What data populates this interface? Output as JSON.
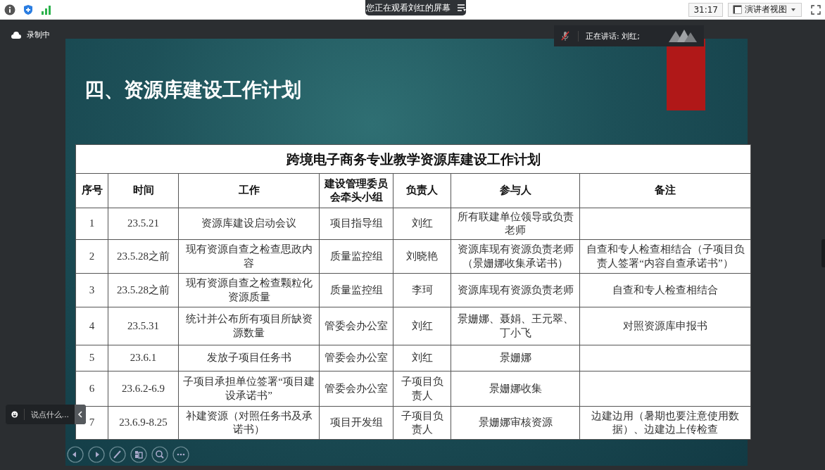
{
  "top_bar": {
    "viewing_banner": "您正在观看刘红的屏幕",
    "timer": "31:17",
    "view_button": "演讲者视图"
  },
  "recording": "录制中",
  "speaking": "正在讲话: 刘红;",
  "slide": {
    "title": "四、资源库建设工作计划",
    "table": {
      "caption": "跨境电子商务专业教学资源库建设工作计划",
      "columns": [
        "序号",
        "时间",
        "工作",
        "建设管理委员会牵头小组",
        "负责人",
        "参与人",
        "备注"
      ],
      "rows": [
        [
          "1",
          "23.5.21",
          "资源库建设启动会议",
          "项目指导组",
          "刘红",
          "所有联建单位领导或负责老师",
          ""
        ],
        [
          "2",
          "23.5.28之前",
          "现有资源自查之检查思政内容",
          "质量监控组",
          "刘晓艳",
          "资源库现有资源负责老师（景姗娜收集承诺书）",
          "自查和专人检查相结合（子项目负责人签署“内容自查承诺书”）"
        ],
        [
          "3",
          "23.5.28之前",
          "现有资源自查之检查颗粒化资源质量",
          "质量监控组",
          "李珂",
          "资源库现有资源负责老师",
          "自查和专人检查相结合"
        ],
        [
          "4",
          "23.5.31",
          "统计并公布所有项目所缺资源数量",
          "管委会办公室",
          "刘红",
          "景姗娜、聂娟、王元翠、丁小飞",
          "对照资源库申报书"
        ],
        [
          "5",
          "23.6.1",
          "发放子项目任务书",
          "管委会办公室",
          "刘红",
          "景姗娜",
          ""
        ],
        [
          "6",
          "23.6.2-6.9",
          "子项目承担单位签署“项目建设承诺书”",
          "管委会办公室",
          "子项目负责人",
          "景姗娜收集",
          ""
        ],
        [
          "7",
          "23.6.9-8.25",
          "补建资源（对照任务书及承诺书）",
          "项目开发组",
          "子项目负责人",
          "景姗娜审核资源",
          "边建边用（暑期也要注意使用数据）、边建边上传检查"
        ]
      ]
    }
  },
  "chat": {
    "placeholder": "说点什么..."
  }
}
